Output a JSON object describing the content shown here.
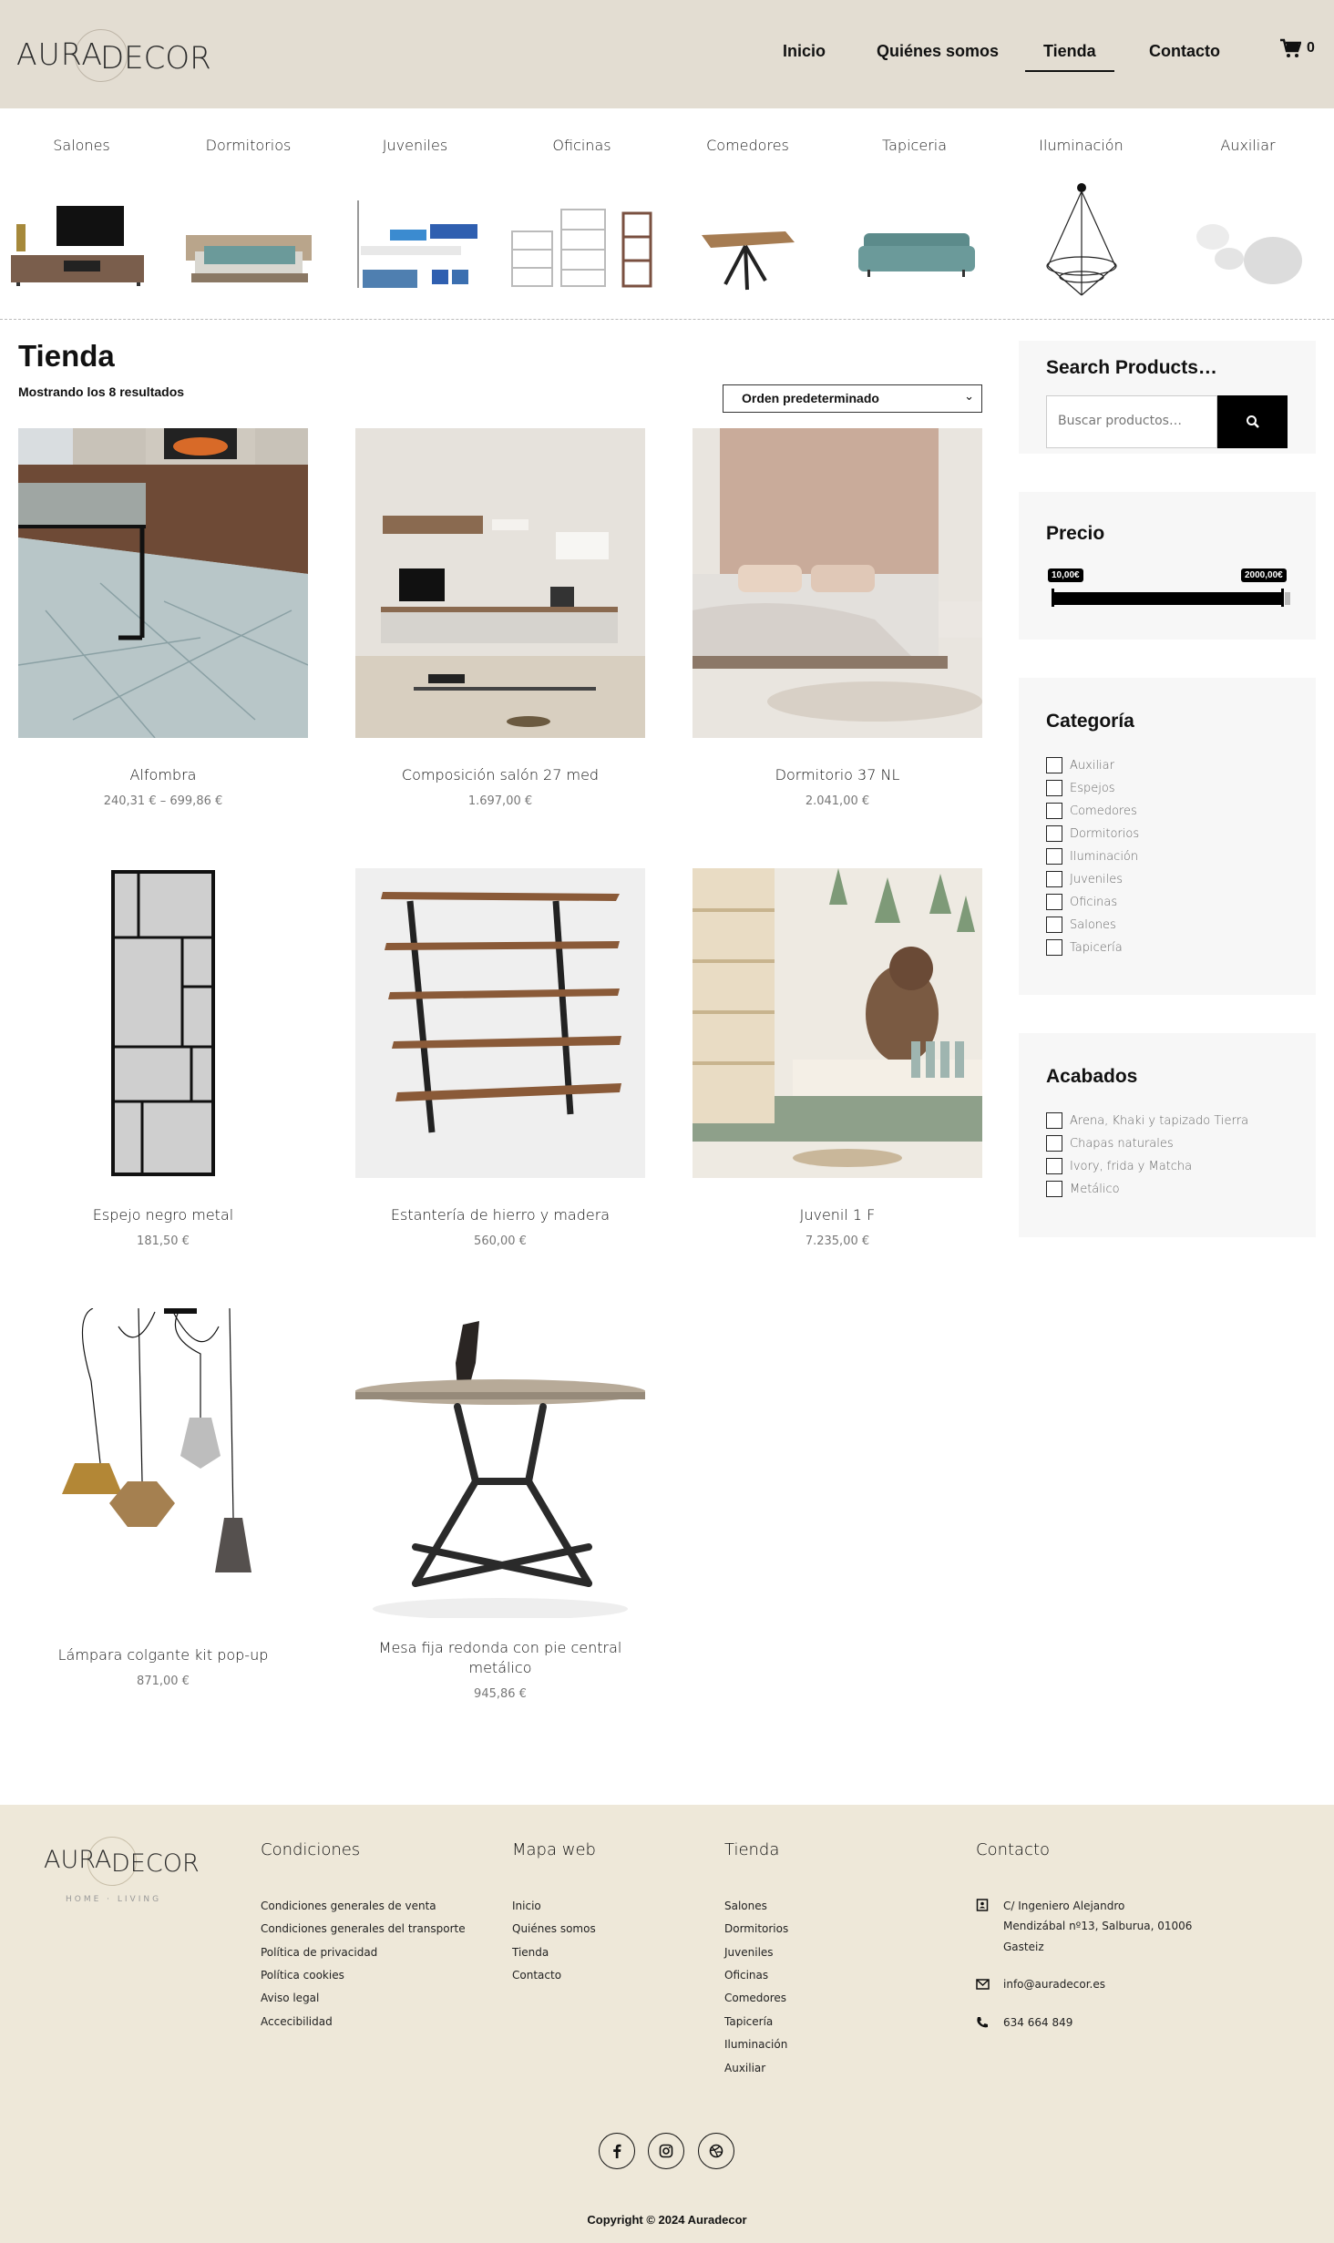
{
  "header": {
    "logo_part1": "AURA",
    "logo_part2": "DECOR",
    "nav": [
      "Inicio",
      "Quiénes somos",
      "Tienda",
      "Contacto"
    ],
    "cart_count": "0"
  },
  "categories": [
    "Salones",
    "Dormitorios",
    "Juveniles",
    "Oficinas",
    "Comedores",
    "Tapiceria",
    "Iluminación",
    "Auxiliar"
  ],
  "shop": {
    "title": "Tienda",
    "result_count": "Mostrando los 8 resultados",
    "sort_label": "Orden predeterminado"
  },
  "products": [
    {
      "name": "Alfombra",
      "price": "240,31 € – 699,86 €"
    },
    {
      "name": "Composición salón 27 med",
      "price": "1.697,00 €"
    },
    {
      "name": "Dormitorio 37 NL",
      "price": "2.041,00 €"
    },
    {
      "name": "Espejo negro metal",
      "price": "181,50 €"
    },
    {
      "name": "Estantería de hierro y madera",
      "price": "560,00 €"
    },
    {
      "name": "Juvenil 1 F",
      "price": "7.235,00 €"
    },
    {
      "name": "Lámpara colgante kit pop-up",
      "price": "871,00 €"
    },
    {
      "name": "Mesa fija redonda con pie central metálico",
      "price": "945,86 €"
    }
  ],
  "sidebar": {
    "search_title": "Search Products…",
    "search_placeholder": "Buscar productos…",
    "price_title": "Precio",
    "price_min": "10,00€",
    "price_max": "2000,00€",
    "price_range_fraction": [
      0,
      1
    ],
    "category_title": "Categoría",
    "category_items": [
      "Auxiliar",
      "Espejos",
      "Comedores",
      "Dormitorios",
      "Iluminación",
      "Juveniles",
      "Oficinas",
      "Salones",
      "Tapicería"
    ],
    "finish_title": "Acabados",
    "finish_items": [
      "Arena, Khaki y tapizado Tierra",
      "Chapas naturales",
      "Ivory, frida y Matcha",
      "Metálico"
    ]
  },
  "footer": {
    "logo_part1": "AURA",
    "logo_part2": "DECOR",
    "logo_tagline": "HOME · LIVING",
    "conditions_title": "Condiciones",
    "conditions_links": [
      "Condiciones generales de venta",
      "Condiciones generales del transporte",
      "Política de privacidad",
      "Política cookies",
      "Aviso legal",
      "Accecibilidad"
    ],
    "sitemap_title": "Mapa web",
    "sitemap_links": [
      "Inicio",
      "Quiénes somos",
      "Tienda",
      "Contacto"
    ],
    "shop_title": "Tienda",
    "shop_links": [
      "Salones",
      "Dormitorios",
      "Juveniles",
      "Oficinas",
      "Comedores",
      "Tapicería",
      "Iluminación",
      "Auxiliar"
    ],
    "contact_title": "Contacto",
    "address_line1": "C/ Ingeniero Alejandro",
    "address_line2": "Mendizábal nº13, Salburua, 01006",
    "address_line3": "Gasteiz",
    "email": "info@auradecor.es",
    "phone": "634 664 849",
    "copyright": "Copyright © 2024 Auradecor"
  }
}
